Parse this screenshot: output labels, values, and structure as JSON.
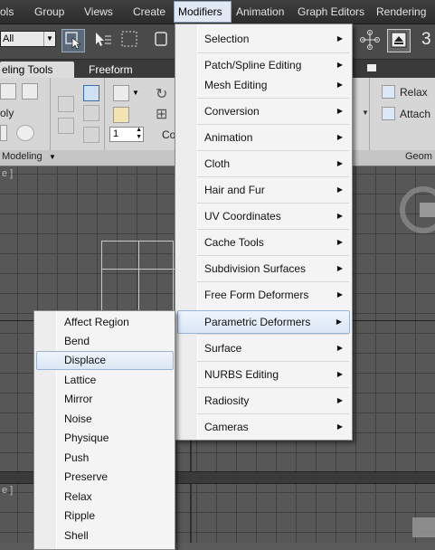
{
  "menubar": {
    "items": [
      "ols",
      "Group",
      "Views",
      "Create",
      "Modifiers",
      "Animation",
      "Graph Editors",
      "Rendering"
    ]
  },
  "toolbar": {
    "selection_filter": "All",
    "right_number": "3"
  },
  "ribbon": {
    "tabs": [
      "eling Tools",
      "Freeform"
    ],
    "labels": {
      "poly": "oly",
      "spinner": "1",
      "co": "Co",
      "relax": "Relax",
      "attach": "Attach"
    },
    "footer": {
      "modeling": "Modeling",
      "geom": "Geom"
    }
  },
  "modifiers_menu": {
    "items": [
      "Selection",
      "Patch/Spline Editing",
      "Mesh Editing",
      "Conversion",
      "Animation",
      "Cloth",
      "Hair and Fur",
      "UV Coordinates",
      "Cache Tools",
      "Subdivision Surfaces",
      "Free Form Deformers",
      "Parametric Deformers",
      "Surface",
      "NURBS Editing",
      "Radiosity",
      "Cameras"
    ],
    "highlighted": "Parametric Deformers"
  },
  "parametric_menu": {
    "items": [
      "Affect Region",
      "Bend",
      "Displace",
      "Lattice",
      "Mirror",
      "Noise",
      "Physique",
      "Push",
      "Preserve",
      "Relax",
      "Ripple",
      "Shell"
    ],
    "highlighted": "Displace"
  },
  "colors": {
    "menubar_bg": "#333333",
    "menu_bg": "#f4f4f4",
    "highlight": "#dbe7f5",
    "viewport_bg": "#575757"
  }
}
